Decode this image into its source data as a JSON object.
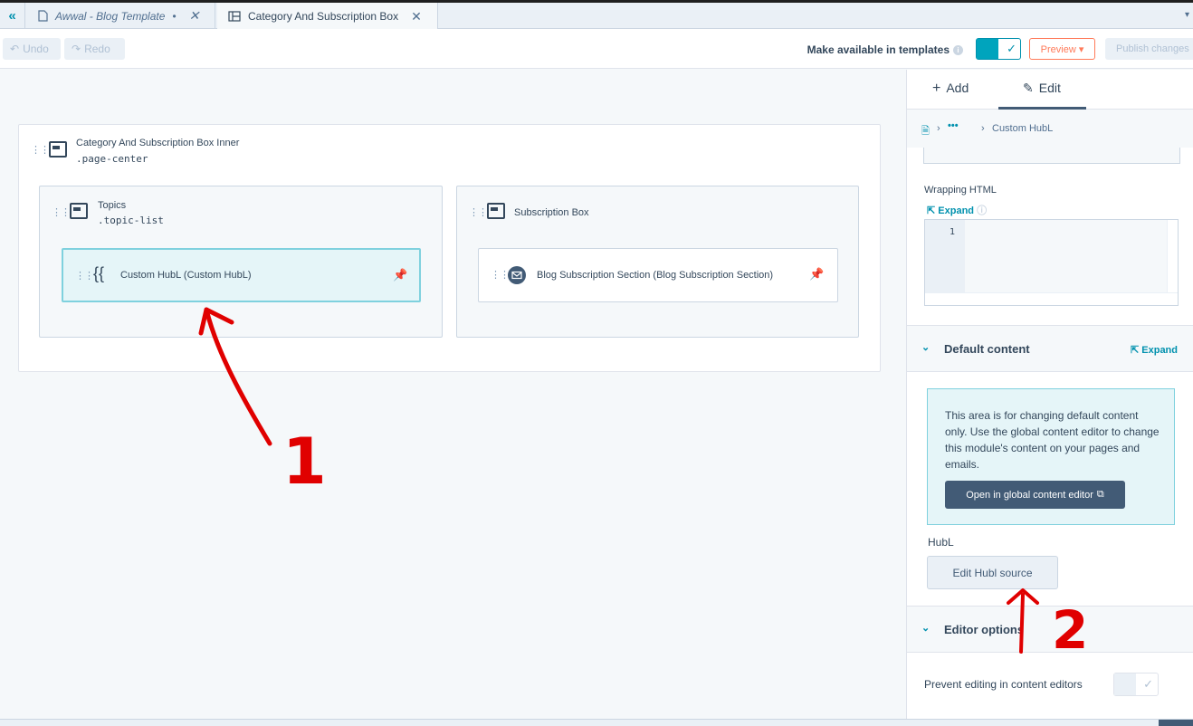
{
  "tabs": {
    "back_icon": "double-chevron-left-icon",
    "tab1_label": "Awwal - Blog Template",
    "tab1_dot": "•",
    "tab2_label": "Category And Subscription Box",
    "close": "✕"
  },
  "toolbar": {
    "undo": "Undo",
    "redo": "Redo",
    "make_available": "Make available in templates",
    "preview": "Preview ▾",
    "publish": "Publish changes"
  },
  "canvas": {
    "outer": {
      "label": "Category And Subscription Box Inner",
      "class": ".page-center"
    },
    "topics": {
      "label": "Topics",
      "class": ".topic-list"
    },
    "subscription": {
      "label": "Subscription Box"
    },
    "hubl_module": {
      "label": "Custom HubL (Custom HubL)",
      "icon": "{{"
    },
    "blog_module": {
      "label": "Blog Subscription Section (Blog Subscription Section)"
    }
  },
  "panel": {
    "tab_add": "Add",
    "tab_edit": "Edit",
    "breadcrumb": {
      "dots": "•••",
      "current": "Custom HubL"
    },
    "wrapping_label": "Wrapping HTML",
    "expand": "Expand",
    "code_line": "1",
    "default_content": "Default content",
    "info_text": "This area is for changing default content only. Use the global content editor to change this module's content on your pages and emails.",
    "open_global": "Open in global content editor",
    "hubl_label": "HubL",
    "edit_hubl": "Edit Hubl source",
    "editor_options": "Editor options",
    "prevent_editing": "Prevent editing in content editors"
  },
  "annotations": {
    "label1": "1",
    "label2": "2"
  },
  "colors": {
    "accent": "#00a4bd",
    "primary_dark": "#425b76",
    "orange": "#ff7a59",
    "annotation": "#e00000"
  }
}
